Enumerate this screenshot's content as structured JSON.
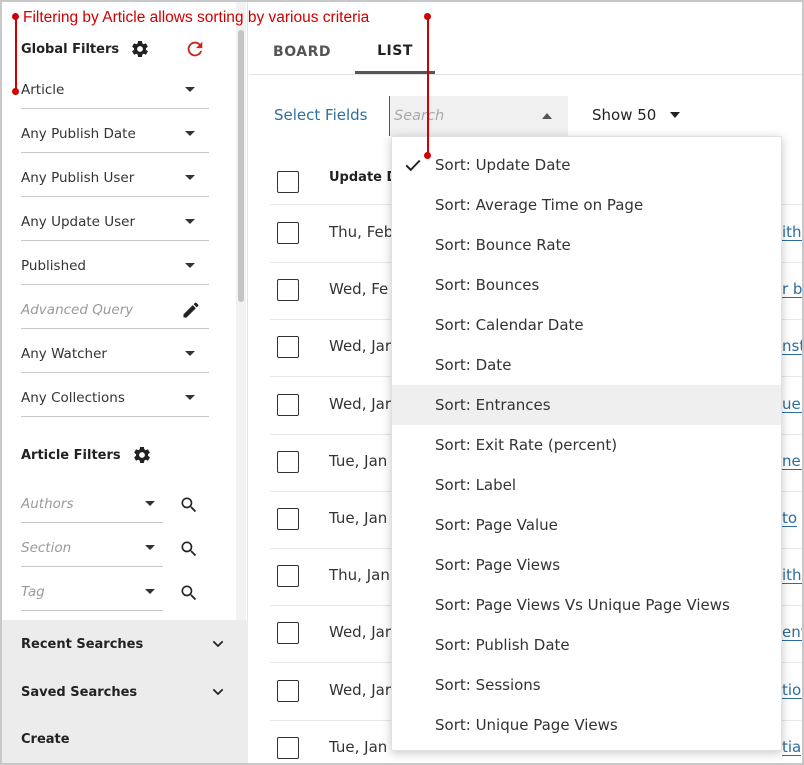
{
  "annotation": "Filtering by Article allows sorting by various criteria",
  "colors": {
    "accent_red": "#d00000",
    "link_blue": "#2e6e9e",
    "refresh_red": "#c62828"
  },
  "sidebar": {
    "global_title": "Global Filters",
    "global_filters": [
      {
        "label": "Article",
        "type": "select"
      },
      {
        "label": "Any Publish Date",
        "type": "select"
      },
      {
        "label": "Any Publish User",
        "type": "select"
      },
      {
        "label": "Any Update User",
        "type": "select"
      },
      {
        "label": "Published",
        "type": "select"
      },
      {
        "label": "Advanced Query",
        "type": "query"
      },
      {
        "label": "Any Watcher",
        "type": "select"
      },
      {
        "label": "Any Collections",
        "type": "select"
      }
    ],
    "article_title": "Article Filters",
    "article_filters": [
      {
        "label": "Authors"
      },
      {
        "label": "Section"
      },
      {
        "label": "Tag"
      }
    ],
    "recent_searches": "Recent Searches",
    "saved_searches": "Saved Searches",
    "create": "Create"
  },
  "tabs": [
    {
      "label": "BOARD",
      "active": false
    },
    {
      "label": "LIST",
      "active": true
    }
  ],
  "toolbar": {
    "select_fields": "Select Fields",
    "search_placeholder": "Search",
    "show": "Show 50"
  },
  "table": {
    "header": "Update D",
    "rows": [
      {
        "date": "Thu, Feb",
        "link": "ith"
      },
      {
        "date": "Wed, Fe",
        "link": "r b"
      },
      {
        "date": "Wed, Jar",
        "link": "nst"
      },
      {
        "date": "Wed, Jar",
        "link": "uer"
      },
      {
        "date": "Tue, Jan",
        "link": "ne s"
      },
      {
        "date": "Tue, Jan",
        "link": "to"
      },
      {
        "date": "Thu, Jan",
        "link": "ith"
      },
      {
        "date": "Wed, Jar",
        "link": "ent"
      },
      {
        "date": "Wed, Jar",
        "link": "tion"
      },
      {
        "date": "Tue, Jan",
        "link": "tia"
      }
    ]
  },
  "sort_menu": {
    "selected_index": 0,
    "hover_index": 6,
    "items": [
      "Sort: Update Date",
      "Sort: Average Time on Page",
      "Sort: Bounce Rate",
      "Sort: Bounces",
      "Sort: Calendar Date",
      "Sort: Date",
      "Sort: Entrances",
      "Sort: Exit Rate (percent)",
      "Sort: Label",
      "Sort: Page Value",
      "Sort: Page Views",
      "Sort: Page Views Vs Unique Page Views",
      "Sort: Publish Date",
      "Sort: Sessions",
      "Sort: Unique Page Views"
    ]
  }
}
